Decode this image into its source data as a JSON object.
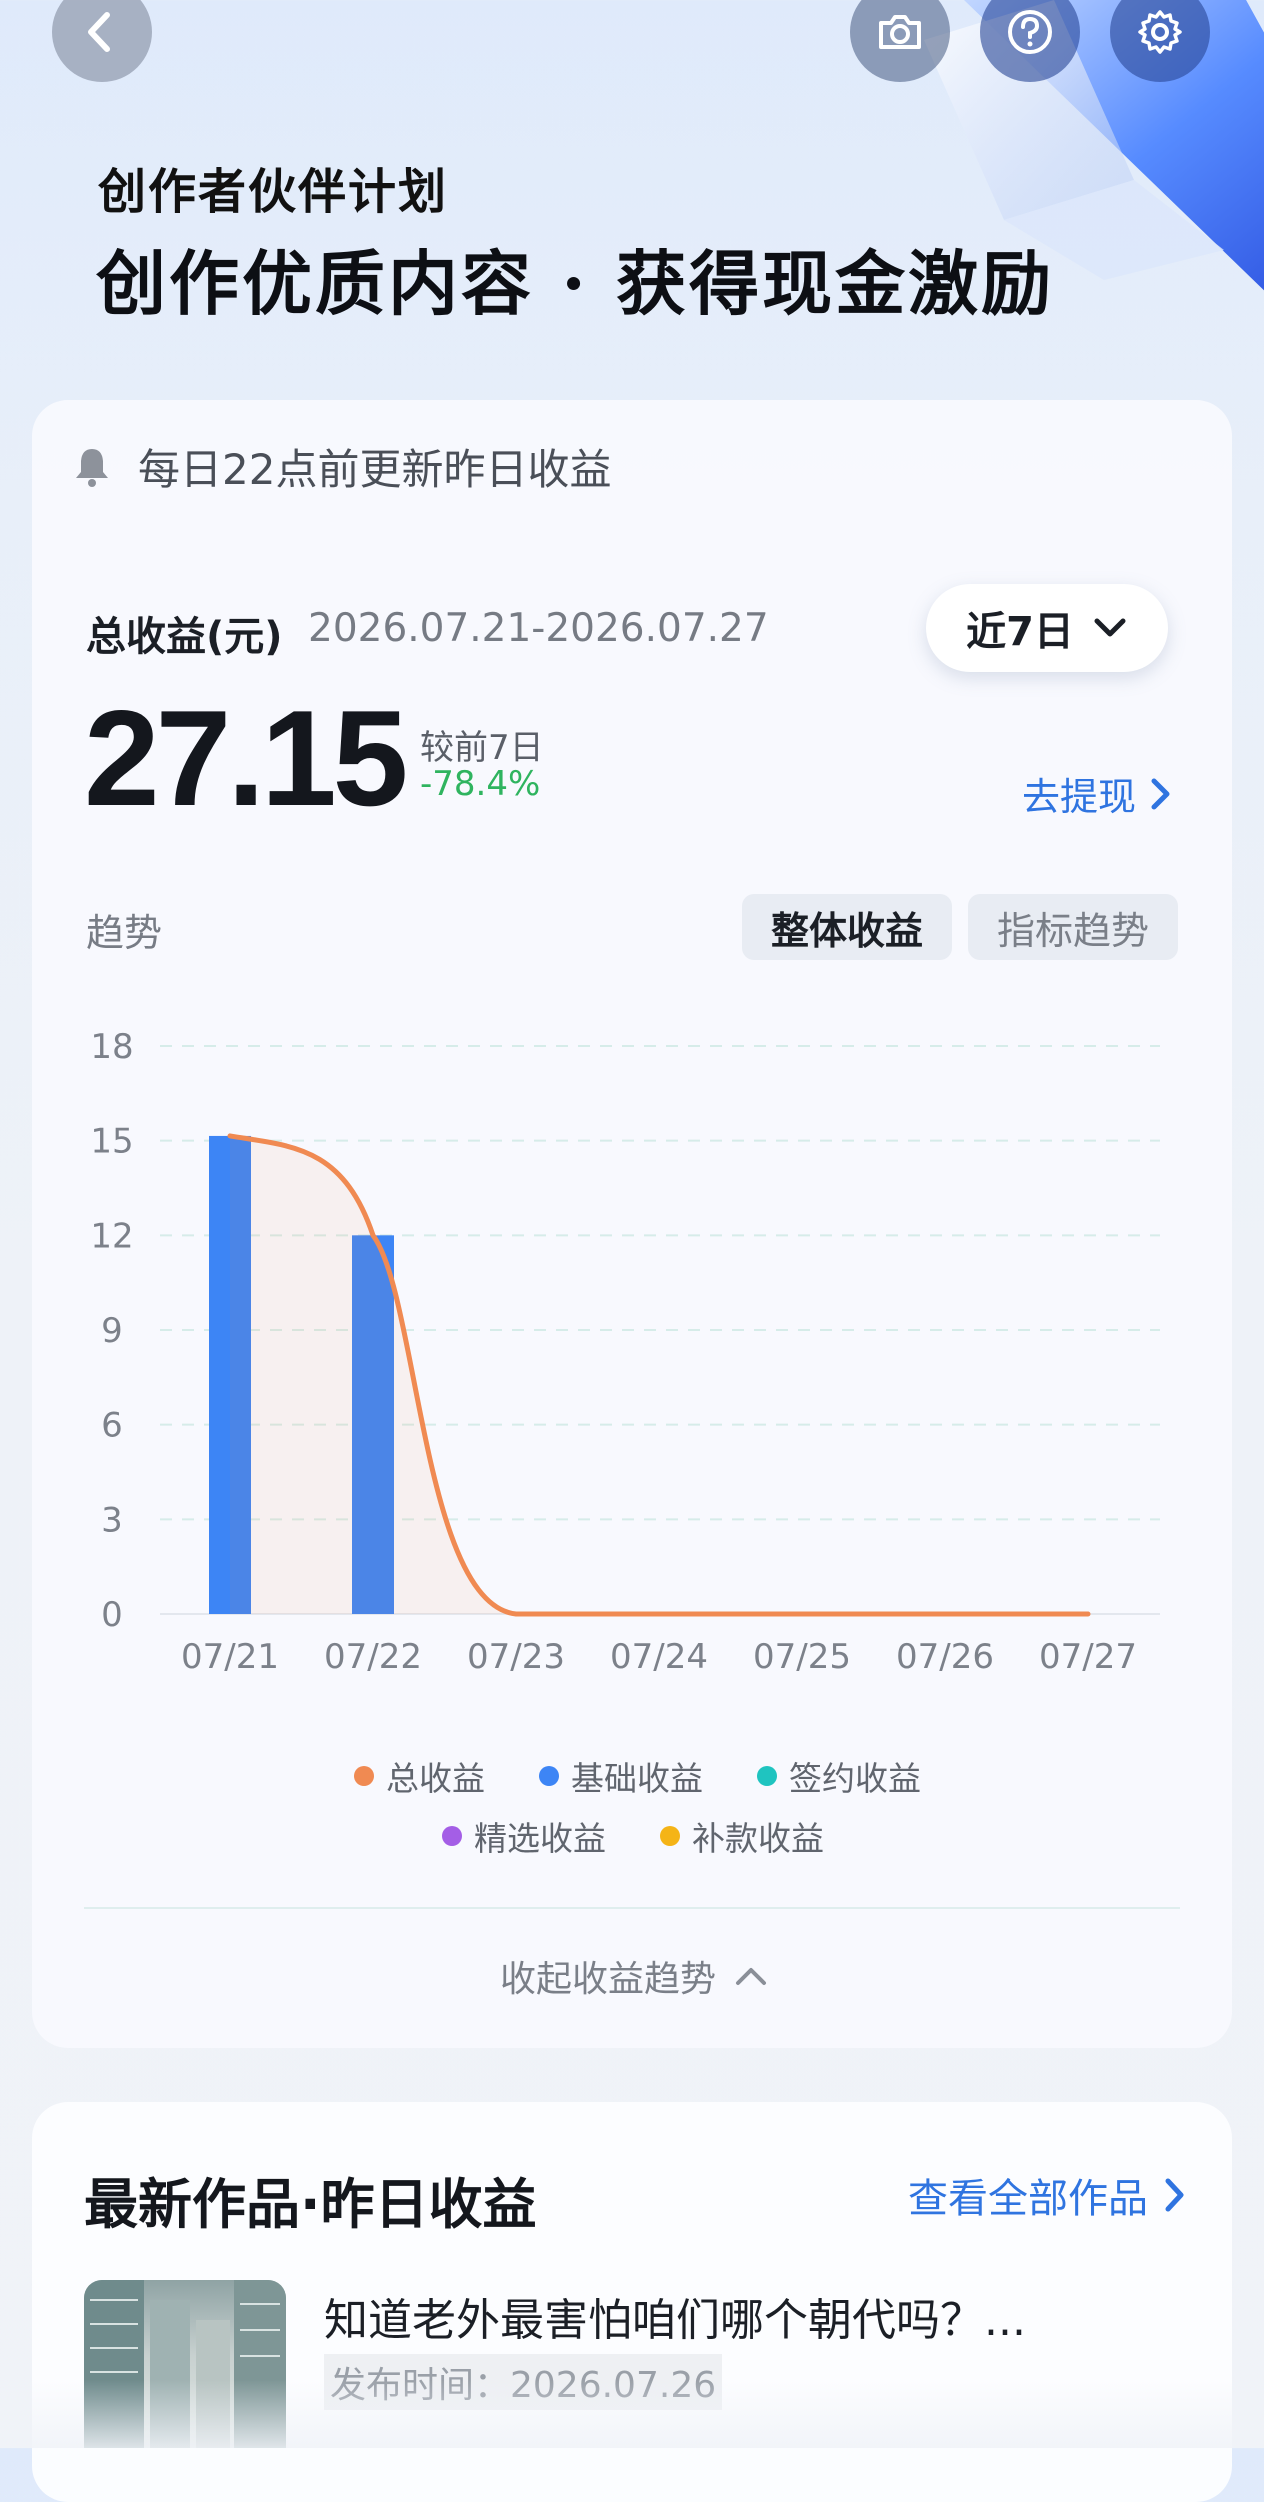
{
  "header": {
    "subtitle": "创作者伙伴计划",
    "title": "创作优质内容 · 获得现金激励"
  },
  "notice": {
    "text": "每日22点前更新昨日收益"
  },
  "summary": {
    "total_label": "总收益(元)",
    "date_range": "2026.07.21-2026.07.27",
    "period": "近7日",
    "total_value": "27.15",
    "compare_label": "较前7日",
    "compare_value": "-78.4%",
    "withdraw": "去提现"
  },
  "trend": {
    "label": "趋势",
    "tabs": [
      "整体收益",
      "指标趋势"
    ]
  },
  "chart_data": {
    "type": "bar",
    "categories": [
      "07/21",
      "07/22",
      "07/23",
      "07/24",
      "07/25",
      "07/26",
      "07/27"
    ],
    "ylim": [
      0,
      18
    ],
    "yticks": [
      0,
      3,
      6,
      9,
      12,
      15,
      18
    ],
    "series": [
      {
        "name": "总收益",
        "type": "line",
        "color": "#f08a52",
        "values": [
          15.15,
          12.0,
          0,
          0,
          0,
          0,
          0
        ]
      },
      {
        "name": "基础收益",
        "type": "bar",
        "color": "#3d85f5",
        "values": [
          15.15,
          12.0,
          0,
          0,
          0,
          0,
          0
        ]
      },
      {
        "name": "签约收益",
        "type": "line",
        "color": "#1fc4c0",
        "values": [
          0,
          0,
          0,
          0,
          0,
          0,
          0
        ]
      },
      {
        "name": "精选收益",
        "type": "line",
        "color": "#a45ee6",
        "values": [
          0,
          0,
          0,
          0,
          0,
          0,
          0
        ]
      },
      {
        "name": "补款收益",
        "type": "line",
        "color": "#f5b417",
        "values": [
          0,
          0,
          0,
          0,
          0,
          0,
          0
        ]
      }
    ],
    "grid": true
  },
  "collapse": {
    "label": "收起收益趋势"
  },
  "latest": {
    "title": "最新作品·昨日收益",
    "view_all": "查看全部作品",
    "works": [
      {
        "title": "知道老外最害怕咱们哪个朝代吗？...",
        "date": "发布时间：2026.07.26"
      }
    ]
  },
  "icons": [
    "back-arrow-icon",
    "camera-icon",
    "help-icon",
    "settings-icon",
    "bell-icon",
    "chevron-down-icon",
    "chevron-right-icon",
    "chevron-up-icon"
  ]
}
